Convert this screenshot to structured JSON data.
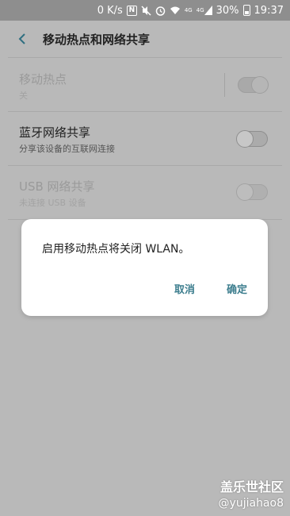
{
  "status_bar": {
    "network_speed": "0 K/s",
    "signal_labels": [
      "4G",
      "4G"
    ],
    "battery_percent": "30%",
    "time": "19:37",
    "icons": [
      "nfc-icon",
      "mute-icon",
      "alarm-icon",
      "wifi-icon",
      "signal-icon",
      "battery-icon"
    ]
  },
  "header": {
    "title": "移动热点和网络共享"
  },
  "settings": {
    "hotspot": {
      "title": "移动热点",
      "subtitle": "关",
      "enabled": false,
      "switch_on": true
    },
    "bluetooth_tethering": {
      "title": "蓝牙网络共享",
      "subtitle": "分享该设备的互联网连接",
      "enabled": true,
      "switch_on": false
    },
    "usb_tethering": {
      "title": "USB 网络共享",
      "subtitle": "未连接 USB 设备",
      "enabled": false,
      "switch_on": false
    }
  },
  "dialog": {
    "message": "启用移动热点将关闭 WLAN。",
    "cancel_label": "取消",
    "confirm_label": "确定"
  },
  "watermark": {
    "title": "盖乐世社区",
    "user": "@yujiahao8"
  },
  "colors": {
    "accent": "#3d7e8e",
    "scrim_background": "#b9b9b9"
  }
}
